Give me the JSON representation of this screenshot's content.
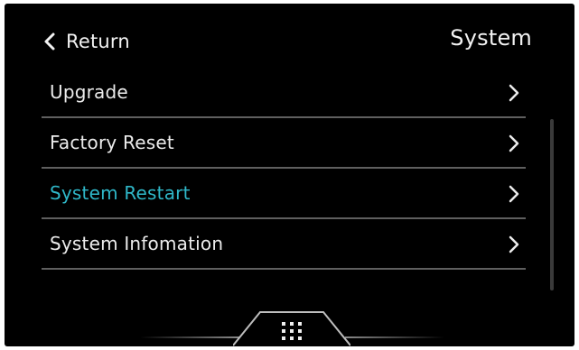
{
  "header": {
    "back_label": "Return",
    "title": "System"
  },
  "menu": {
    "items": [
      {
        "label": "Upgrade",
        "active": false
      },
      {
        "label": "Factory Reset",
        "active": false
      },
      {
        "label": "System Restart",
        "active": true
      },
      {
        "label": "System Infomation",
        "active": false
      }
    ]
  },
  "icons": {
    "back": "chevron-left-icon",
    "item_arrow": "chevron-right-icon",
    "drawer": "grid-dots-icon"
  },
  "colors": {
    "background": "#000000",
    "text": "#ececec",
    "active_text": "#2fb7c8",
    "divider": "#5f5f5f"
  }
}
